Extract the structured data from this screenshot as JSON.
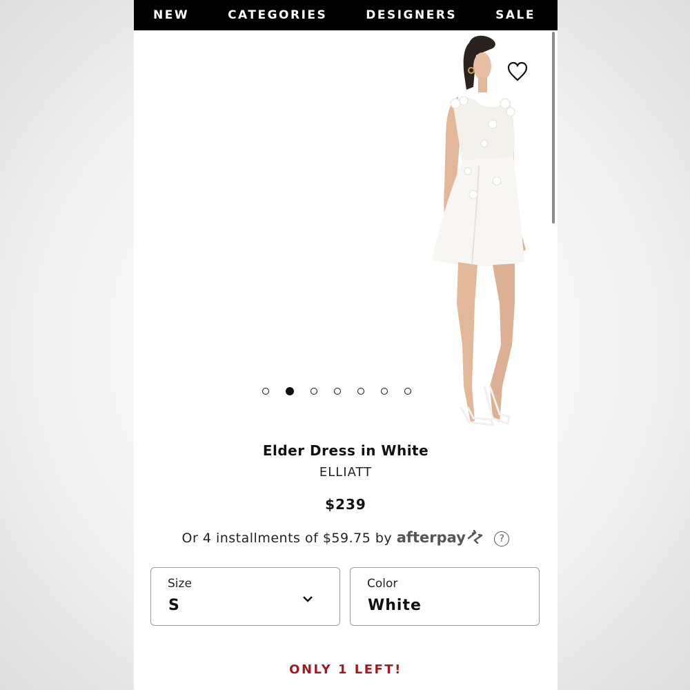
{
  "nav": {
    "items": [
      "NEW",
      "CATEGORIES",
      "DESIGNERS",
      "SALE"
    ]
  },
  "product": {
    "name": "Elder Dress in White",
    "brand": "ELLIATT",
    "price": "$239",
    "installments_prefix": "Or 4 installments of $59.75 by",
    "afterpay_logo": "afterpay",
    "help_icon": "?",
    "stock_message": "ONLY 1 LEFT!"
  },
  "carousel": {
    "total": 7,
    "active_index": 1
  },
  "size": {
    "label": "Size",
    "value": "S"
  },
  "color": {
    "label": "Color",
    "value": "White"
  },
  "colors": {
    "nav_bg": "#000000",
    "stock": "#a2191f",
    "afterpay_grey": "#555555"
  },
  "icons": [
    "heart-icon",
    "chevron-down-icon",
    "help-circle-icon",
    "afterpay-arrows-icon"
  ]
}
